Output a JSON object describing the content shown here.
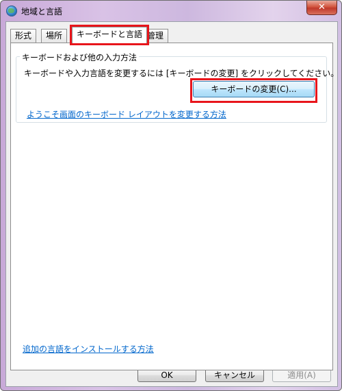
{
  "window": {
    "title": "地域と言語",
    "close_label": "✕"
  },
  "tabs": [
    {
      "label": "形式"
    },
    {
      "label": "場所"
    },
    {
      "label": "キーボードと言語"
    },
    {
      "label": "管理"
    }
  ],
  "keyboard_group": {
    "title": "キーボードおよび他の入力方法",
    "description": "キーボードや入力言語を変更するには [キーボードの変更] をクリックしてください。",
    "change_button": "キーボードの変更(C)...",
    "welcome_link": "ようこそ画面のキーボード レイアウトを変更する方法"
  },
  "install_link": "追加の言語をインストールする方法",
  "footer": {
    "ok": "OK",
    "cancel": "キャンセル",
    "apply": "適用(A)"
  },
  "highlight_color": "#e8151b"
}
